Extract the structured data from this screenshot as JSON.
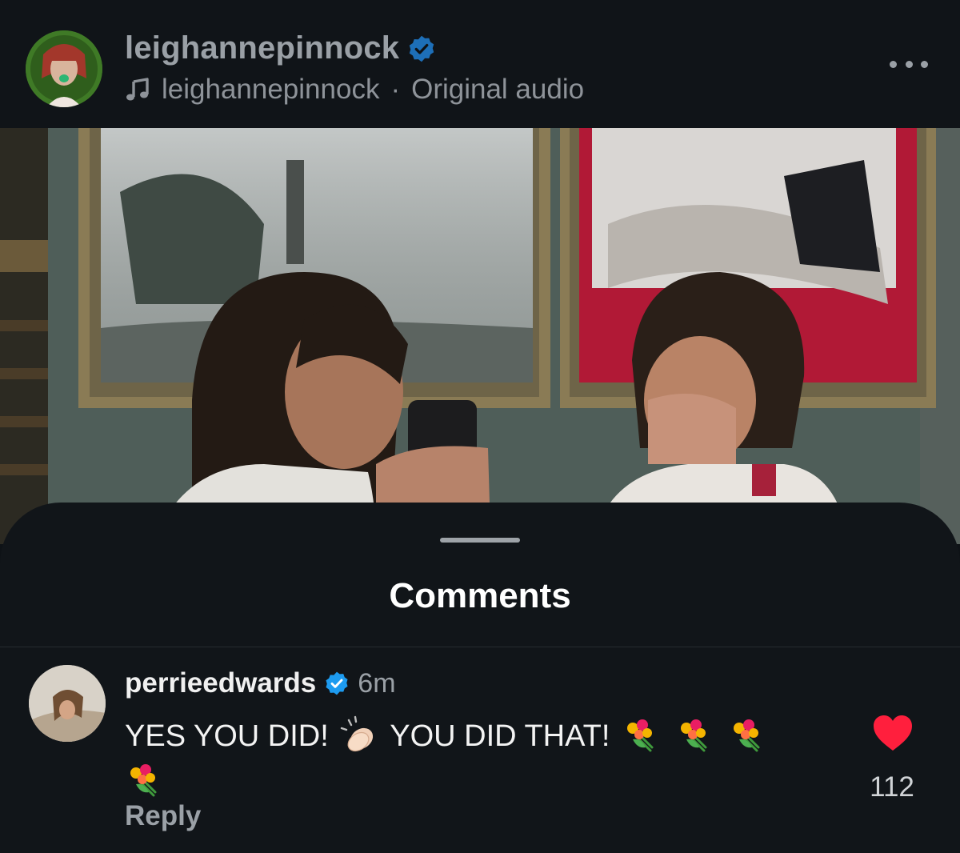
{
  "post": {
    "username": "leighannepinnock",
    "audio_author": "leighannepinnock",
    "audio_separator": "·",
    "audio_title": "Original audio",
    "verified_icon": "verified-badge-icon",
    "more_icon": "more-options-icon",
    "music_icon": "music-note-icon"
  },
  "comments_sheet": {
    "title": "Comments"
  },
  "comments": [
    {
      "username": "perrieedwards",
      "time": "6m",
      "text_part1": "YES YOU DID!",
      "text_part2": "YOU DID THAT!",
      "emojis": [
        "clapping-hands-emoji",
        "bouquet-emoji"
      ],
      "reply_label": "Reply",
      "like_count": "112",
      "liked": true
    }
  ],
  "colors": {
    "verified": "#1d9bf0",
    "like": "#ff1f3d",
    "background": "#111519"
  }
}
